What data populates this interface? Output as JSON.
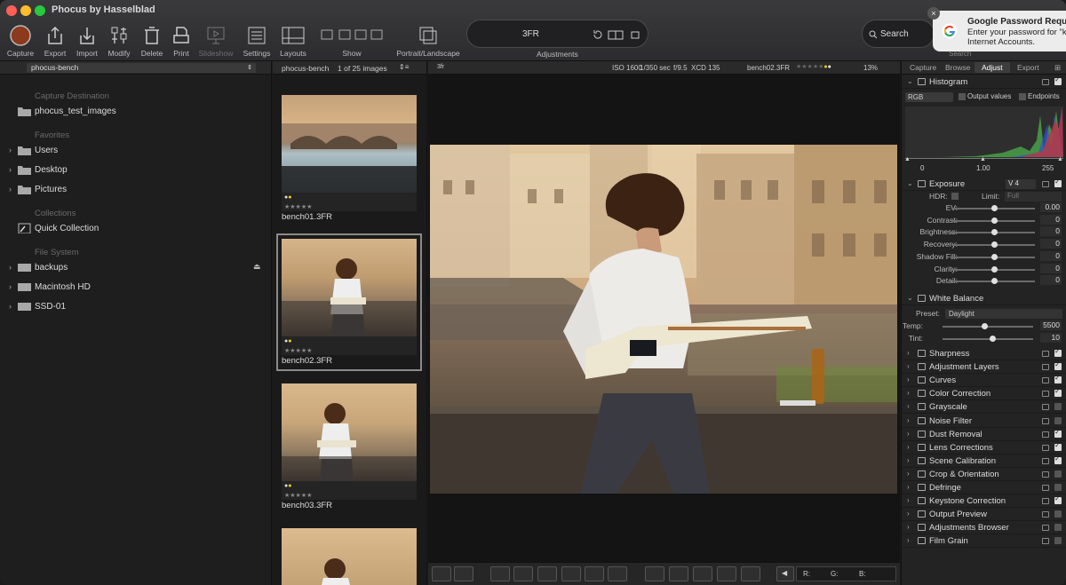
{
  "window": {
    "title": "Phocus by Hasselblad"
  },
  "toolbar": {
    "capture": "Capture",
    "export": "Export",
    "import": "Import",
    "modify": "Modify",
    "delete": "Delete",
    "print": "Print",
    "slideshow": "Slideshow",
    "settings": "Settings",
    "layouts": "Layouts",
    "show": "Show",
    "portrait_landscape": "Portrait/Landscape",
    "adjustments": "Adjustments",
    "format": "3FR",
    "search": "Search",
    "search_label": "Search"
  },
  "notification": {
    "title": "Google Password Requirе",
    "line1": "Enter your password for \"k",
    "line2": "Internet Accounts."
  },
  "browser": {
    "folder": "phocus-bench",
    "capture_dest_label": "Capture Destination",
    "capture_dest": "phocus_test_images",
    "favorites_label": "Favorites",
    "favorites": [
      "Users",
      "Desktop",
      "Pictures"
    ],
    "collections_label": "Collections",
    "quick_collection": "Quick Collection",
    "filesystem_label": "File System",
    "volumes": [
      "backups",
      "Macintosh HD",
      "SSD-01"
    ]
  },
  "thumbnails": {
    "folder": "phocus-bench",
    "count": "1 of 25 images",
    "items": [
      {
        "name": "bench01.3FR"
      },
      {
        "name": "bench02.3FR"
      },
      {
        "name": "bench03.3FR"
      }
    ]
  },
  "viewer": {
    "format_badge": "3fr",
    "iso": "ISO 1600",
    "shutter": "1/350 sec",
    "aperture": "f/9.5",
    "lens": "XCD 135",
    "filename": "bench02.3FR",
    "zoom": "13%",
    "rgb": {
      "r": "R:",
      "g": "G:",
      "b": "B:"
    }
  },
  "right": {
    "tabs": [
      "Capture",
      "Browse",
      "Adjust",
      "Export"
    ],
    "histogram": {
      "title": "Histogram",
      "channel": "RGB",
      "output_values": "Output values",
      "endpoints": "Endpoints",
      "black": "0",
      "gamma": "1.00",
      "white": "255"
    },
    "exposure": {
      "title": "Exposure",
      "version": "V 4",
      "hdr": "HDR:",
      "limit_label": "Limit:",
      "limit": "Full",
      "sliders": [
        {
          "label": "EV:",
          "value": "0.00"
        },
        {
          "label": "Contrast:",
          "value": "0"
        },
        {
          "label": "Brightness:",
          "value": "0"
        },
        {
          "label": "Recovery:",
          "value": "0"
        },
        {
          "label": "Shadow Fill:",
          "value": "0"
        },
        {
          "label": "Clarity:",
          "value": "0"
        },
        {
          "label": "Detail:",
          "value": "0"
        }
      ]
    },
    "white_balance": {
      "title": "White Balance",
      "preset_label": "Preset:",
      "preset": "Daylight",
      "temp_label": "Temp:",
      "temp": "5500",
      "tint_label": "Tint:",
      "tint": "10"
    },
    "tools": [
      "Sharpness",
      "Adjustment Layers",
      "Curves",
      "Color Correction",
      "Grayscale",
      "Noise Filter",
      "Dust Removal",
      "Lens Corrections",
      "Scene Calibration",
      "Crop & Orientation",
      "Defringe",
      "Keystone Correction",
      "Output Preview",
      "Adjustments Browser",
      "Film Grain"
    ]
  }
}
